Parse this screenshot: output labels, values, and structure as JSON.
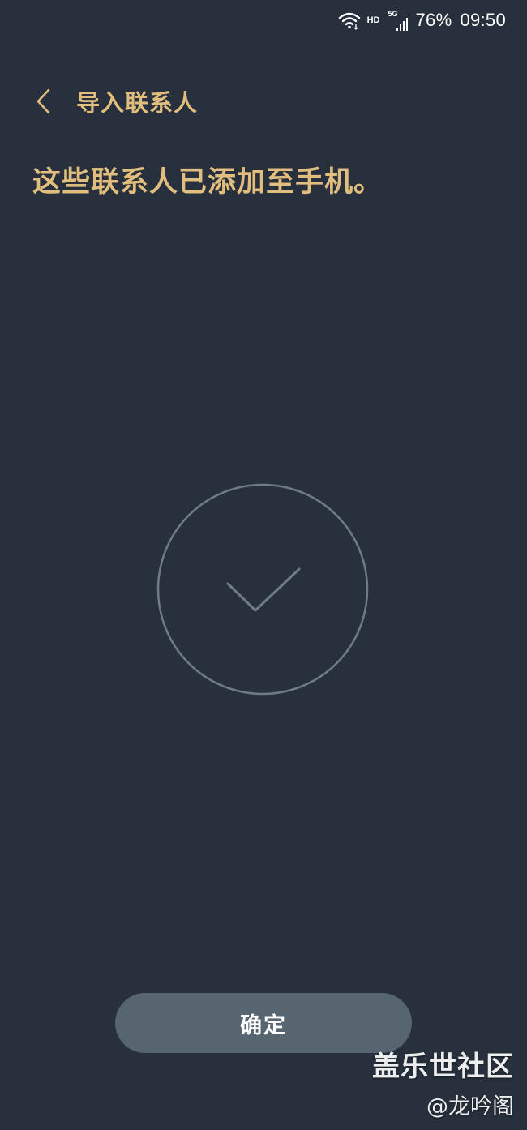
{
  "status_bar": {
    "hd_label": "HD",
    "network_label": "5G",
    "battery": "76%",
    "time": "09:50",
    "icons": [
      "wifi-icon",
      "signal-icon"
    ]
  },
  "header": {
    "back_icon": "chevron-left-icon",
    "title": "导入联系人"
  },
  "message": {
    "headline": "这些联系人已添加至手机。"
  },
  "status_graphic": {
    "icon": "checkmark-circle-icon"
  },
  "actions": {
    "confirm_label": "确定"
  },
  "watermark": {
    "name": "盖乐世社区",
    "handle": "@龙吟阁"
  },
  "colors": {
    "background": "#27303c",
    "accent_gold": "#e2be7e",
    "button": "#566570",
    "circle_stroke": "#6d7c88"
  }
}
